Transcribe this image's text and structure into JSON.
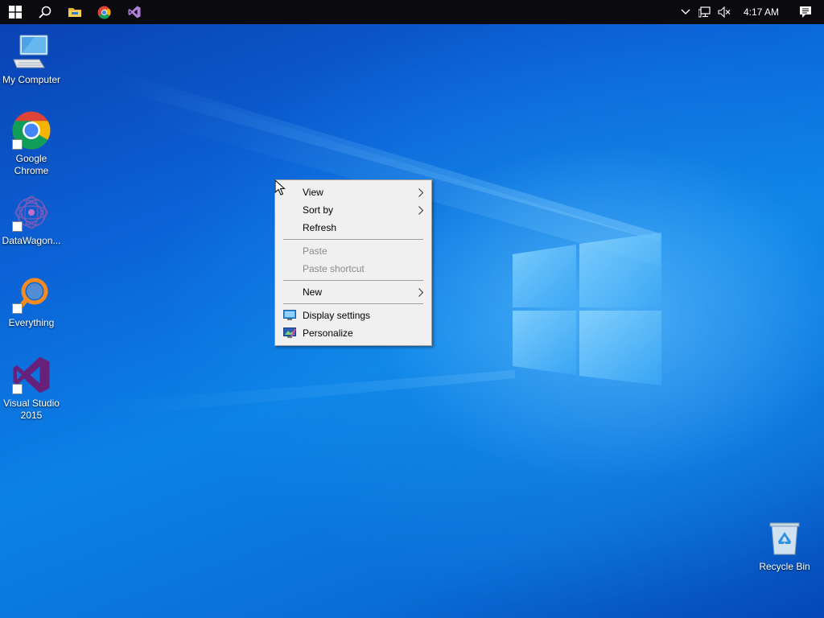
{
  "taskbar": {
    "clock": "4:17 AM",
    "background": "#0a0a0f"
  },
  "desktop_icons": [
    {
      "label": "My Computer",
      "icon": "computer-icon"
    },
    {
      "label": "Google Chrome",
      "icon": "chrome-icon"
    },
    {
      "label": "DataWagon...",
      "icon": "datawagon-icon"
    },
    {
      "label": "Everything",
      "icon": "everything-icon"
    },
    {
      "label": "Visual Studio 2015",
      "icon": "visual-studio-icon"
    },
    {
      "label": "Recycle Bin",
      "icon": "recycle-bin-icon"
    }
  ],
  "context_menu": {
    "view": "View",
    "sort_by": "Sort by",
    "refresh": "Refresh",
    "paste": "Paste",
    "paste_shortcut": "Paste shortcut",
    "new": "New",
    "display_settings": "Display settings",
    "personalize": "Personalize"
  },
  "colors": {
    "accent_blue": "#0b78e3",
    "menu_bg": "#f0f0f0",
    "disabled_text": "#8c8c8c"
  }
}
